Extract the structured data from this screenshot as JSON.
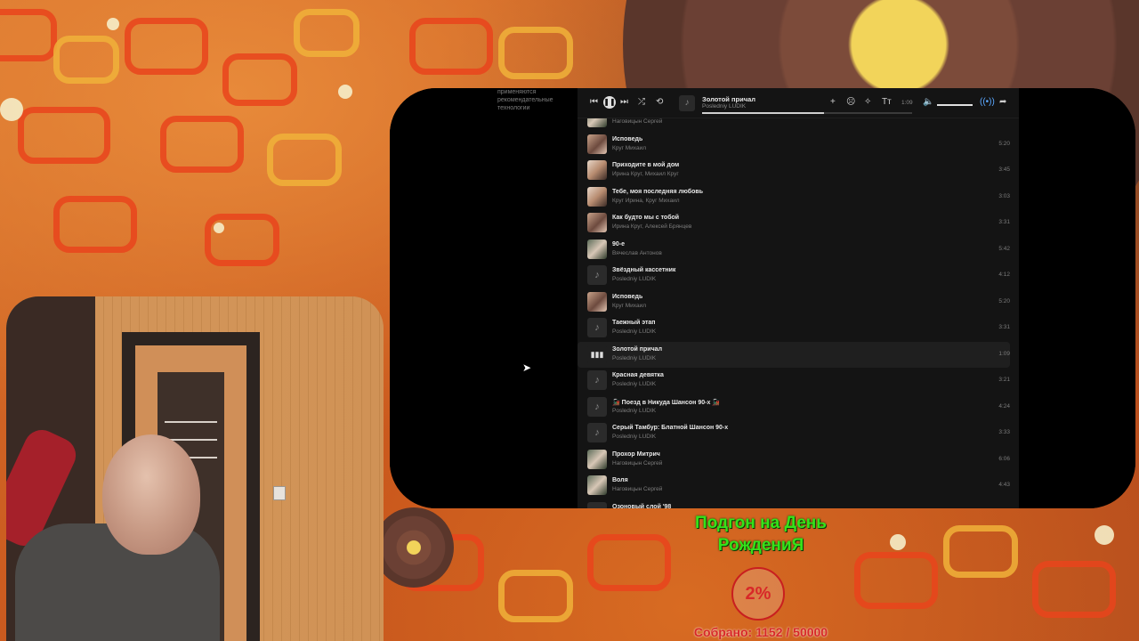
{
  "sidebar": {
    "partial_text": "применяются рекомендательные технологии"
  },
  "player": {
    "now_playing_title": "Золотой причал",
    "now_playing_artist": "Posledniy LUDIK",
    "time": "1:09",
    "progress_fraction": 0.58,
    "volume_fraction": 0.9,
    "icons": [
      "prev-icon",
      "pause-icon",
      "next-icon",
      "shuffle-icon",
      "repeat-icon",
      "add-icon",
      "dislike-icon",
      "recommend-icon",
      "text-icon",
      "mute-icon",
      "broadcast-icon",
      "share-icon"
    ]
  },
  "tracks": [
    {
      "title": "",
      "artist": "Наговицын Сергей",
      "duration": "",
      "thumb": "photo3"
    },
    {
      "title": "Исповедь",
      "artist": "Круг Михаил",
      "duration": "5:20",
      "thumb": "photo"
    },
    {
      "title": "Приходите в мой дом",
      "artist": "Ирина Круг, Михаил Круг",
      "duration": "3:45",
      "thumb": "photo2"
    },
    {
      "title": "Тебе, моя последняя любовь",
      "artist": "Круг Ирина, Круг Михаил",
      "duration": "3:03",
      "thumb": "photo2"
    },
    {
      "title": "Как будто мы с тобой",
      "artist": "Ирина Круг, Алексей Брянцев",
      "duration": "3:31",
      "thumb": "photo"
    },
    {
      "title": "90-е",
      "artist": "Вячеслав Антонов",
      "duration": "5:42",
      "thumb": "photo3"
    },
    {
      "title": "Звёздный кассетник",
      "artist": "Posledniy LUDIK",
      "duration": "4:12",
      "thumb": "note"
    },
    {
      "title": "Исповедь",
      "artist": "Круг Михаил",
      "duration": "5:20",
      "thumb": "photo"
    },
    {
      "title": "Таежный этап",
      "artist": "Posledniy LUDIK",
      "duration": "3:31",
      "thumb": "note"
    },
    {
      "title": "Золотой причал",
      "artist": "Posledniy LUDIK",
      "duration": "1:09",
      "thumb": "eq",
      "active": true
    },
    {
      "title": "Красная девятка",
      "artist": "Posledniy LUDIK",
      "duration": "3:21",
      "thumb": "note"
    },
    {
      "title": "🚂 Поезд в Никуда Шансон 90-х 🚂",
      "artist": "Posledniy LUDIK",
      "duration": "4:24",
      "thumb": "note"
    },
    {
      "title": "Серый Тамбур: Блатной Шансон 90-х",
      "artist": "Posledniy LUDIK",
      "duration": "3:33",
      "thumb": "note"
    },
    {
      "title": "Прохор Митрич",
      "artist": "Наговицын Сергей",
      "duration": "6:06",
      "thumb": "photo3"
    },
    {
      "title": "Воля",
      "artist": "Наговицын Сергей",
      "duration": "4:43",
      "thumb": "photo3"
    },
    {
      "title": "Озоновый слой '98",
      "artist": "",
      "duration": "",
      "thumb": "note"
    }
  ],
  "donation": {
    "title": "Подгон на День РождениЯ",
    "percent": "2%",
    "collected": "Собрано: 1152 / 50000"
  },
  "colors": {
    "accent_green": "#35e21a",
    "accent_red": "#d82828",
    "panel": "#141414"
  }
}
